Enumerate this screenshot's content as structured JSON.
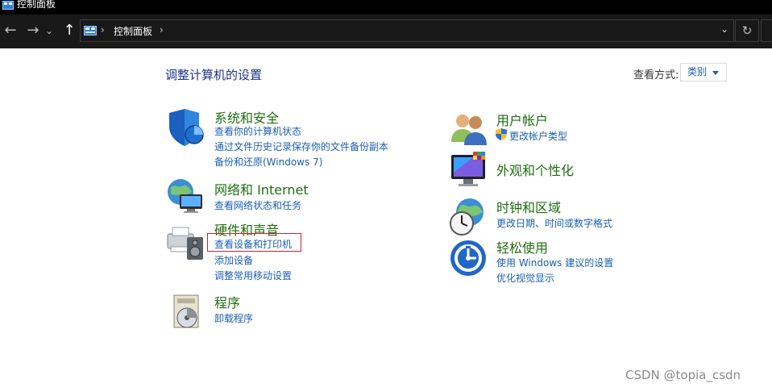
{
  "window": {
    "title": "控制面板"
  },
  "navbar": {
    "breadcrumb": "控制面板",
    "back_glyph": "←",
    "forward_glyph": "→",
    "history_glyph": "⌄",
    "up_glyph": "↑",
    "dropdown_glyph": "⌄",
    "refresh_glyph": "↻"
  },
  "main": {
    "heading": "调整计算机的设置",
    "view_by_label": "查看方式:",
    "view_by_value": "类别"
  },
  "categories": {
    "system_security": {
      "title": "系统和安全",
      "links": [
        "查看你的计算机状态",
        "通过文件历史记录保存你的文件备份副本",
        "备份和还原(Windows 7)"
      ]
    },
    "network": {
      "title": "网络和 Internet",
      "links": [
        "查看网络状态和任务"
      ]
    },
    "hardware": {
      "title": "硬件和声音",
      "links": [
        "查看设备和打印机",
        "添加设备",
        "调整常用移动设置"
      ]
    },
    "programs": {
      "title": "程序",
      "links": [
        "卸载程序"
      ]
    },
    "user_accounts": {
      "title": "用户帐户",
      "links": [
        "更改帐户类型"
      ]
    },
    "appearance": {
      "title": "外观和个性化",
      "links": []
    },
    "clock_region": {
      "title": "时钟和区域",
      "links": [
        "更改日期、时间或数字格式"
      ]
    },
    "ease_of_access": {
      "title": "轻松使用",
      "links": [
        "使用 Windows 建议的设置",
        "优化视觉显示"
      ]
    }
  },
  "watermark": "CSDN @topia_csdn",
  "colors": {
    "category_title": "#1e6e0f",
    "link": "#1a5fb4",
    "heading": "#1e3287",
    "highlight_border": "#d0202a"
  }
}
